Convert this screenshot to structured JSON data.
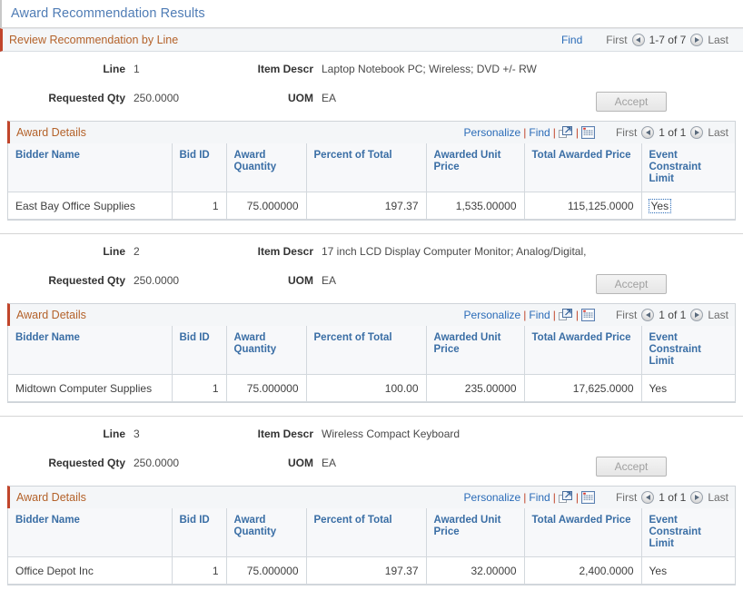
{
  "page": {
    "title": "Award Recommendation Results"
  },
  "group": {
    "title": "Review Recommendation by Line",
    "find_label": "Find",
    "pager": {
      "first": "First",
      "count": "1-7 of 7",
      "last": "Last",
      "prev_icon": "prev-arrow-icon",
      "next_icon": "next-arrow-icon"
    }
  },
  "labels": {
    "line": "Line",
    "item_descr": "Item Descr",
    "requested_qty": "Requested Qty",
    "uom": "UOM",
    "accept": "Accept"
  },
  "grid_toolbar": {
    "title": "Award Details",
    "personalize": "Personalize",
    "find": "Find",
    "separator": "|",
    "expand_icon": "expand-grid-icon",
    "download_icon": "download-spreadsheet-icon",
    "pager": {
      "first": "First",
      "count": "1 of 1",
      "last": "Last"
    }
  },
  "columns": [
    "Bidder Name",
    "Bid ID",
    "Award Quantity",
    "Percent of Total",
    "Awarded Unit Price",
    "Total Awarded Price",
    "Event Constraint Limit"
  ],
  "lines": [
    {
      "line_no": "1",
      "item_descr": "Laptop Notebook PC; Wireless; DVD +/- RW",
      "requested_qty": "250.0000",
      "uom": "EA",
      "rows": [
        {
          "bidder_name": "East Bay Office Supplies",
          "bid_id": "1",
          "award_quantity": "75.000000",
          "percent_of_total": "197.37",
          "awarded_unit_price": "1,535.00000",
          "total_awarded_price": "115,125.0000",
          "event_constraint_limit": "Yes",
          "focused": true
        }
      ]
    },
    {
      "line_no": "2",
      "item_descr": "17 inch LCD Display Computer Monitor; Analog/Digital,",
      "requested_qty": "250.0000",
      "uom": "EA",
      "rows": [
        {
          "bidder_name": "Midtown Computer Supplies",
          "bid_id": "1",
          "award_quantity": "75.000000",
          "percent_of_total": "100.00",
          "awarded_unit_price": "235.00000",
          "total_awarded_price": "17,625.0000",
          "event_constraint_limit": "Yes",
          "focused": false
        }
      ]
    },
    {
      "line_no": "3",
      "item_descr": "Wireless Compact Keyboard",
      "requested_qty": "250.0000",
      "uom": "EA",
      "rows": [
        {
          "bidder_name": "Office Depot Inc",
          "bid_id": "1",
          "award_quantity": "75.000000",
          "percent_of_total": "197.37",
          "awarded_unit_price": "32.00000",
          "total_awarded_price": "2,400.0000",
          "event_constraint_limit": "Yes",
          "focused": false
        }
      ]
    }
  ],
  "colors": {
    "title_blue": "#4f7cb5",
    "section_orange": "#b4622a",
    "accent_red": "#c1452b",
    "link_blue": "#2b6cb8",
    "header_blue": "#3a6ea5"
  }
}
